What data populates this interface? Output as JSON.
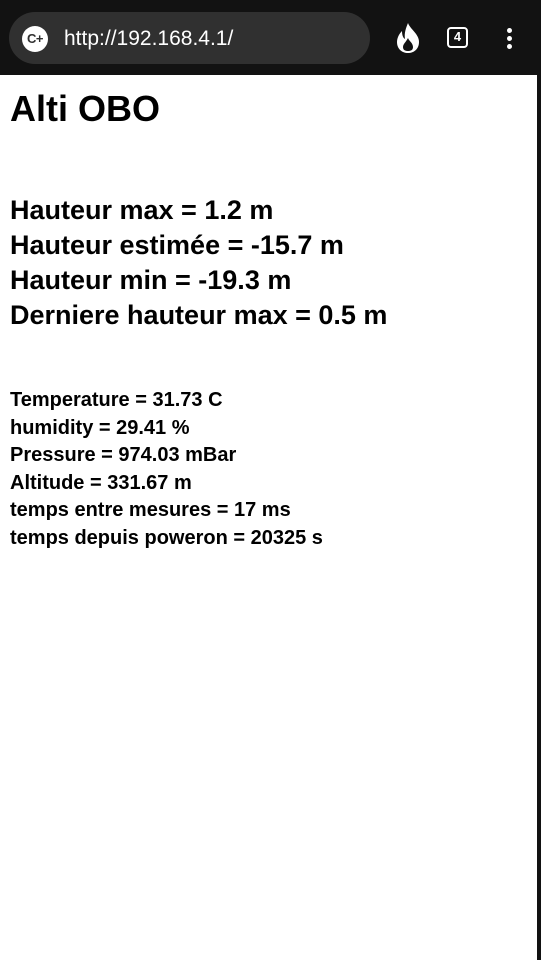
{
  "browser": {
    "url": "http://192.168.4.1/",
    "site_icon": "C+",
    "tab_count": "4",
    "icons": {
      "site": "site-info-icon",
      "flame": "flame-icon",
      "tabs": "tab-switcher-icon",
      "menu": "more-vert-icon"
    }
  },
  "page": {
    "title": "Alti OBO",
    "heights": [
      "Hauteur max = 1.2 m",
      "Hauteur estimée = -15.7 m",
      "Hauteur min = -19.3 m",
      "Derniere hauteur max = 0.5 m"
    ],
    "sensors": [
      "Temperature = 31.73 C",
      "humidity = 29.41 %",
      "Pressure = 974.03 mBar",
      "Altitude = 331.67 m",
      "temps entre mesures = 17 ms",
      "temps depuis poweron = 20325 s"
    ]
  },
  "colors": {
    "toolbar": "#121212",
    "url_pill": "#303030",
    "text": "#000000",
    "background": "#ffffff"
  }
}
